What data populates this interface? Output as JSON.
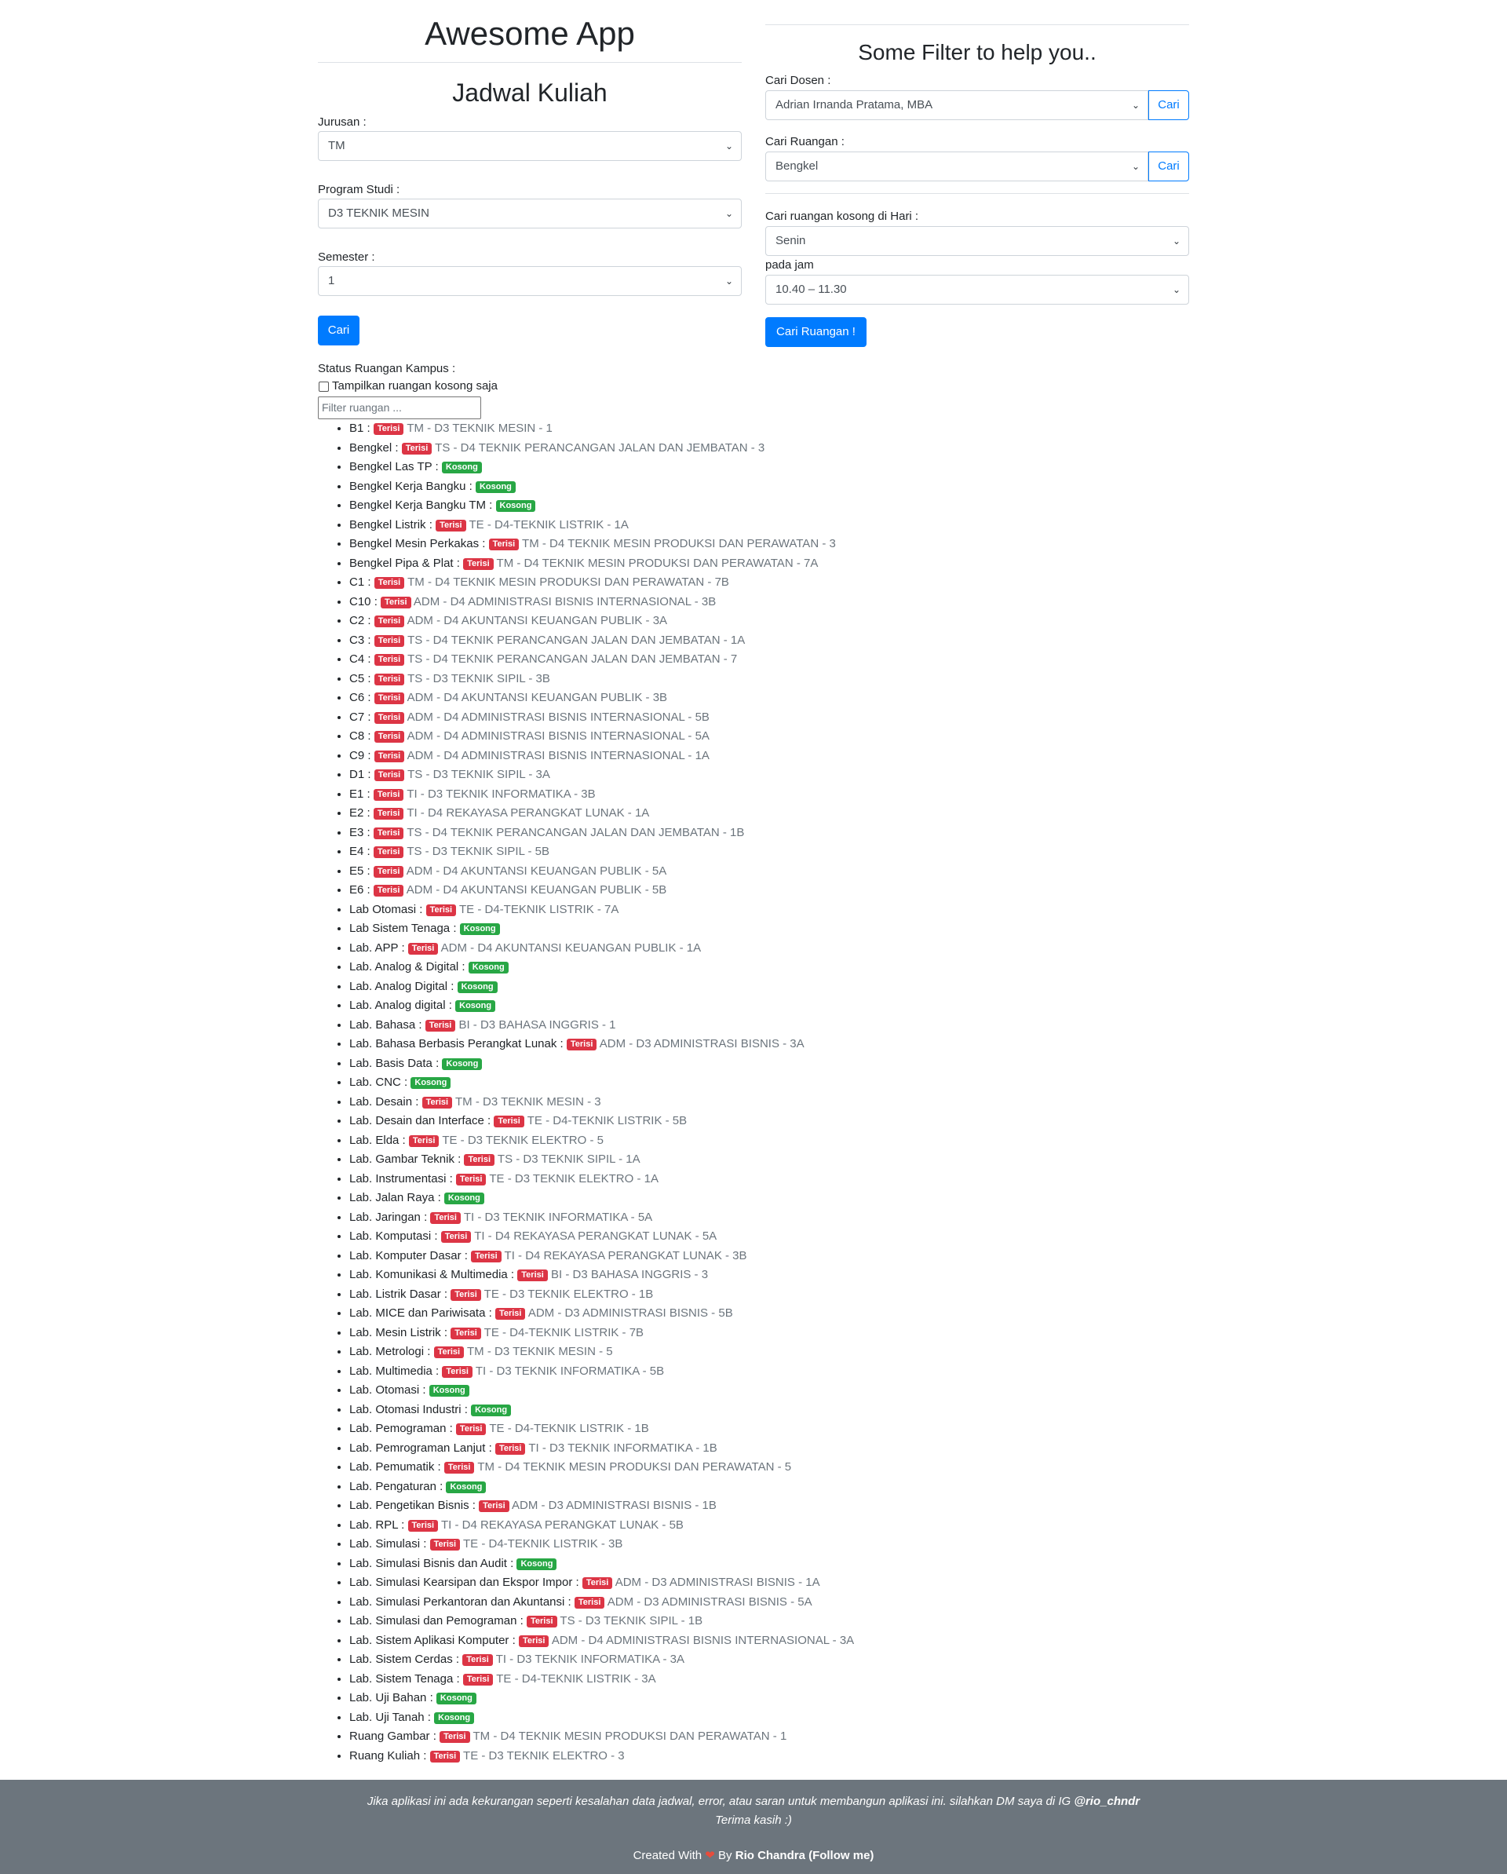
{
  "app_title": "Awesome App",
  "left": {
    "title": "Jadwal Kuliah",
    "jurusan_label": "Jurusan :",
    "jurusan_value": "TM",
    "prodi_label": "Program Studi :",
    "prodi_value": "D3 TEKNIK MESIN",
    "semester_label": "Semester :",
    "semester_value": "1",
    "cari_button": "Cari"
  },
  "right": {
    "title": "Some Filter to help you..",
    "dosen_label": "Cari Dosen :",
    "dosen_value": "Adrian Irnanda Pratama, MBA",
    "dosen_button": "Cari",
    "ruangan_label": "Cari Ruangan :",
    "ruangan_value": "Bengkel",
    "ruangan_button": "Cari",
    "hari_label": "Cari ruangan kosong di Hari :",
    "hari_value": "Senin",
    "jam_label": "pada jam",
    "jam_value": "10.40 – 11.30",
    "cari_ruangan_button": "Cari Ruangan !"
  },
  "status": {
    "label": "Status Ruangan Kampus :",
    "checkbox_label": "Tampilkan ruangan kosong saja",
    "filter_placeholder": "Filter ruangan ..."
  },
  "colors": {
    "terisi": "#dc3545",
    "kosong": "#28a745",
    "primary": "#007bff",
    "footer": "#6c757d"
  },
  "rooms": [
    {
      "name": "B1",
      "status": "Terisi",
      "info": "TM - D3 TEKNIK MESIN - 1"
    },
    {
      "name": "Bengkel",
      "status": "Terisi",
      "info": "TS - D4 TEKNIK PERANCANGAN JALAN DAN JEMBATAN - 3"
    },
    {
      "name": "Bengkel Las TP",
      "status": "Kosong",
      "info": ""
    },
    {
      "name": "Bengkel Kerja Bangku",
      "status": "Kosong",
      "info": ""
    },
    {
      "name": "Bengkel Kerja Bangku TM",
      "status": "Kosong",
      "info": ""
    },
    {
      "name": "Bengkel Listrik",
      "status": "Terisi",
      "info": "TE - D4-TEKNIK LISTRIK - 1A"
    },
    {
      "name": "Bengkel Mesin Perkakas",
      "status": "Terisi",
      "info": "TM - D4 TEKNIK MESIN PRODUKSI DAN PERAWATAN - 3"
    },
    {
      "name": "Bengkel Pipa & Plat",
      "status": "Terisi",
      "info": "TM - D4 TEKNIK MESIN PRODUKSI DAN PERAWATAN - 7A"
    },
    {
      "name": "C1",
      "status": "Terisi",
      "info": "TM - D4 TEKNIK MESIN PRODUKSI DAN PERAWATAN - 7B"
    },
    {
      "name": "C10",
      "status": "Terisi",
      "info": "ADM - D4 ADMINISTRASI BISNIS INTERNASIONAL - 3B"
    },
    {
      "name": "C2",
      "status": "Terisi",
      "info": "ADM - D4 AKUNTANSI KEUANGAN PUBLIK - 3A"
    },
    {
      "name": "C3",
      "status": "Terisi",
      "info": "TS - D4 TEKNIK PERANCANGAN JALAN DAN JEMBATAN - 1A"
    },
    {
      "name": "C4",
      "status": "Terisi",
      "info": "TS - D4 TEKNIK PERANCANGAN JALAN DAN JEMBATAN - 7"
    },
    {
      "name": "C5",
      "status": "Terisi",
      "info": "TS - D3 TEKNIK SIPIL - 3B"
    },
    {
      "name": "C6",
      "status": "Terisi",
      "info": "ADM - D4 AKUNTANSI KEUANGAN PUBLIK - 3B"
    },
    {
      "name": "C7",
      "status": "Terisi",
      "info": "ADM - D4 ADMINISTRASI BISNIS INTERNASIONAL - 5B"
    },
    {
      "name": "C8",
      "status": "Terisi",
      "info": "ADM - D4 ADMINISTRASI BISNIS INTERNASIONAL - 5A"
    },
    {
      "name": "C9",
      "status": "Terisi",
      "info": "ADM - D4 ADMINISTRASI BISNIS INTERNASIONAL - 1A"
    },
    {
      "name": "D1",
      "status": "Terisi",
      "info": "TS - D3 TEKNIK SIPIL - 3A"
    },
    {
      "name": "E1",
      "status": "Terisi",
      "info": "TI - D3 TEKNIK INFORMATIKA - 3B"
    },
    {
      "name": "E2",
      "status": "Terisi",
      "info": "TI - D4 REKAYASA PERANGKAT LUNAK - 1A"
    },
    {
      "name": "E3",
      "status": "Terisi",
      "info": "TS - D4 TEKNIK PERANCANGAN JALAN DAN JEMBATAN - 1B"
    },
    {
      "name": "E4",
      "status": "Terisi",
      "info": "TS - D3 TEKNIK SIPIL - 5B"
    },
    {
      "name": "E5",
      "status": "Terisi",
      "info": "ADM - D4 AKUNTANSI KEUANGAN PUBLIK - 5A"
    },
    {
      "name": "E6",
      "status": "Terisi",
      "info": "ADM - D4 AKUNTANSI KEUANGAN PUBLIK - 5B"
    },
    {
      "name": "Lab Otomasi",
      "status": "Terisi",
      "info": "TE - D4-TEKNIK LISTRIK - 7A"
    },
    {
      "name": "Lab Sistem Tenaga",
      "status": "Kosong",
      "info": ""
    },
    {
      "name": "Lab. APP",
      "status": "Terisi",
      "info": "ADM - D4 AKUNTANSI KEUANGAN PUBLIK - 1A"
    },
    {
      "name": "Lab. Analog & Digital",
      "status": "Kosong",
      "info": ""
    },
    {
      "name": "Lab. Analog Digital",
      "status": "Kosong",
      "info": ""
    },
    {
      "name": "Lab. Analog digital",
      "status": "Kosong",
      "info": ""
    },
    {
      "name": "Lab. Bahasa",
      "status": "Terisi",
      "info": "BI - D3 BAHASA INGGRIS - 1"
    },
    {
      "name": "Lab. Bahasa Berbasis Perangkat Lunak",
      "status": "Terisi",
      "info": "ADM - D3 ADMINISTRASI BISNIS - 3A"
    },
    {
      "name": "Lab. Basis Data",
      "status": "Kosong",
      "info": ""
    },
    {
      "name": "Lab. CNC",
      "status": "Kosong",
      "info": ""
    },
    {
      "name": "Lab. Desain",
      "status": "Terisi",
      "info": "TM - D3 TEKNIK MESIN - 3"
    },
    {
      "name": "Lab. Desain dan Interface",
      "status": "Terisi",
      "info": "TE - D4-TEKNIK LISTRIK - 5B"
    },
    {
      "name": "Lab. Elda",
      "status": "Terisi",
      "info": "TE - D3 TEKNIK ELEKTRO - 5"
    },
    {
      "name": "Lab. Gambar Teknik",
      "status": "Terisi",
      "info": "TS - D3 TEKNIK SIPIL - 1A"
    },
    {
      "name": "Lab. Instrumentasi",
      "status": "Terisi",
      "info": "TE - D3 TEKNIK ELEKTRO - 1A"
    },
    {
      "name": "Lab. Jalan Raya",
      "status": "Kosong",
      "info": ""
    },
    {
      "name": "Lab. Jaringan",
      "status": "Terisi",
      "info": "TI - D3 TEKNIK INFORMATIKA - 5A"
    },
    {
      "name": "Lab. Komputasi",
      "status": "Terisi",
      "info": "TI - D4 REKAYASA PERANGKAT LUNAK - 5A"
    },
    {
      "name": "Lab. Komputer Dasar",
      "status": "Terisi",
      "info": "TI - D4 REKAYASA PERANGKAT LUNAK - 3B"
    },
    {
      "name": "Lab. Komunikasi & Multimedia",
      "status": "Terisi",
      "info": "BI - D3 BAHASA INGGRIS - 3"
    },
    {
      "name": "Lab. Listrik Dasar",
      "status": "Terisi",
      "info": "TE - D3 TEKNIK ELEKTRO - 1B"
    },
    {
      "name": "Lab. MICE dan Pariwisata",
      "status": "Terisi",
      "info": "ADM - D3 ADMINISTRASI BISNIS - 5B"
    },
    {
      "name": "Lab. Mesin Listrik",
      "status": "Terisi",
      "info": "TE - D4-TEKNIK LISTRIK - 7B"
    },
    {
      "name": "Lab. Metrologi",
      "status": "Terisi",
      "info": "TM - D3 TEKNIK MESIN - 5"
    },
    {
      "name": "Lab. Multimedia",
      "status": "Terisi",
      "info": "TI - D3 TEKNIK INFORMATIKA - 5B"
    },
    {
      "name": "Lab. Otomasi",
      "status": "Kosong",
      "info": ""
    },
    {
      "name": "Lab. Otomasi Industri",
      "status": "Kosong",
      "info": ""
    },
    {
      "name": "Lab. Pemograman",
      "status": "Terisi",
      "info": "TE - D4-TEKNIK LISTRIK - 1B"
    },
    {
      "name": "Lab. Pemrograman Lanjut",
      "status": "Terisi",
      "info": "TI - D3 TEKNIK INFORMATIKA - 1B"
    },
    {
      "name": "Lab. Pemumatik",
      "status": "Terisi",
      "info": "TM - D4 TEKNIK MESIN PRODUKSI DAN PERAWATAN - 5"
    },
    {
      "name": "Lab. Pengaturan",
      "status": "Kosong",
      "info": ""
    },
    {
      "name": "Lab. Pengetikan Bisnis",
      "status": "Terisi",
      "info": "ADM - D3 ADMINISTRASI BISNIS - 1B"
    },
    {
      "name": "Lab. RPL",
      "status": "Terisi",
      "info": "TI - D4 REKAYASA PERANGKAT LUNAK - 5B"
    },
    {
      "name": "Lab. Simulasi",
      "status": "Terisi",
      "info": "TE - D4-TEKNIK LISTRIK - 3B"
    },
    {
      "name": "Lab. Simulasi Bisnis dan Audit",
      "status": "Kosong",
      "info": ""
    },
    {
      "name": "Lab. Simulasi Kearsipan dan Ekspor Impor",
      "status": "Terisi",
      "info": "ADM - D3 ADMINISTRASI BISNIS - 1A"
    },
    {
      "name": "Lab. Simulasi Perkantoran dan Akuntansi",
      "status": "Terisi",
      "info": "ADM - D3 ADMINISTRASI BISNIS - 5A"
    },
    {
      "name": "Lab. Simulasi dan Pemograman",
      "status": "Terisi",
      "info": "TS - D3 TEKNIK SIPIL - 1B"
    },
    {
      "name": "Lab. Sistem Aplikasi Komputer",
      "status": "Terisi",
      "info": "ADM - D4 ADMINISTRASI BISNIS INTERNASIONAL - 3A"
    },
    {
      "name": "Lab. Sistem Cerdas",
      "status": "Terisi",
      "info": "TI - D3 TEKNIK INFORMATIKA - 3A"
    },
    {
      "name": "Lab. Sistem Tenaga",
      "status": "Terisi",
      "info": "TE - D4-TEKNIK LISTRIK - 3A"
    },
    {
      "name": "Lab. Uji Bahan",
      "status": "Kosong",
      "info": ""
    },
    {
      "name": "Lab. Uji Tanah",
      "status": "Kosong",
      "info": ""
    },
    {
      "name": "Ruang Gambar",
      "status": "Terisi",
      "info": "TM - D4 TEKNIK MESIN PRODUKSI DAN PERAWATAN - 1"
    },
    {
      "name": "Ruang Kuliah",
      "status": "Terisi",
      "info": "TE - D3 TEKNIK ELEKTRO - 3"
    }
  ],
  "footer": {
    "message": "Jika aplikasi ini ada kekurangan seperti kesalahan data jadwal, error, atau saran untuk membangun aplikasi ini. silahkan DM saya di IG",
    "ig_handle": "@rio_chndr",
    "thanks": "Terima kasih :)",
    "created_with": "Created With",
    "by": "By",
    "author_link": "Rio Chandra (Follow me)"
  }
}
